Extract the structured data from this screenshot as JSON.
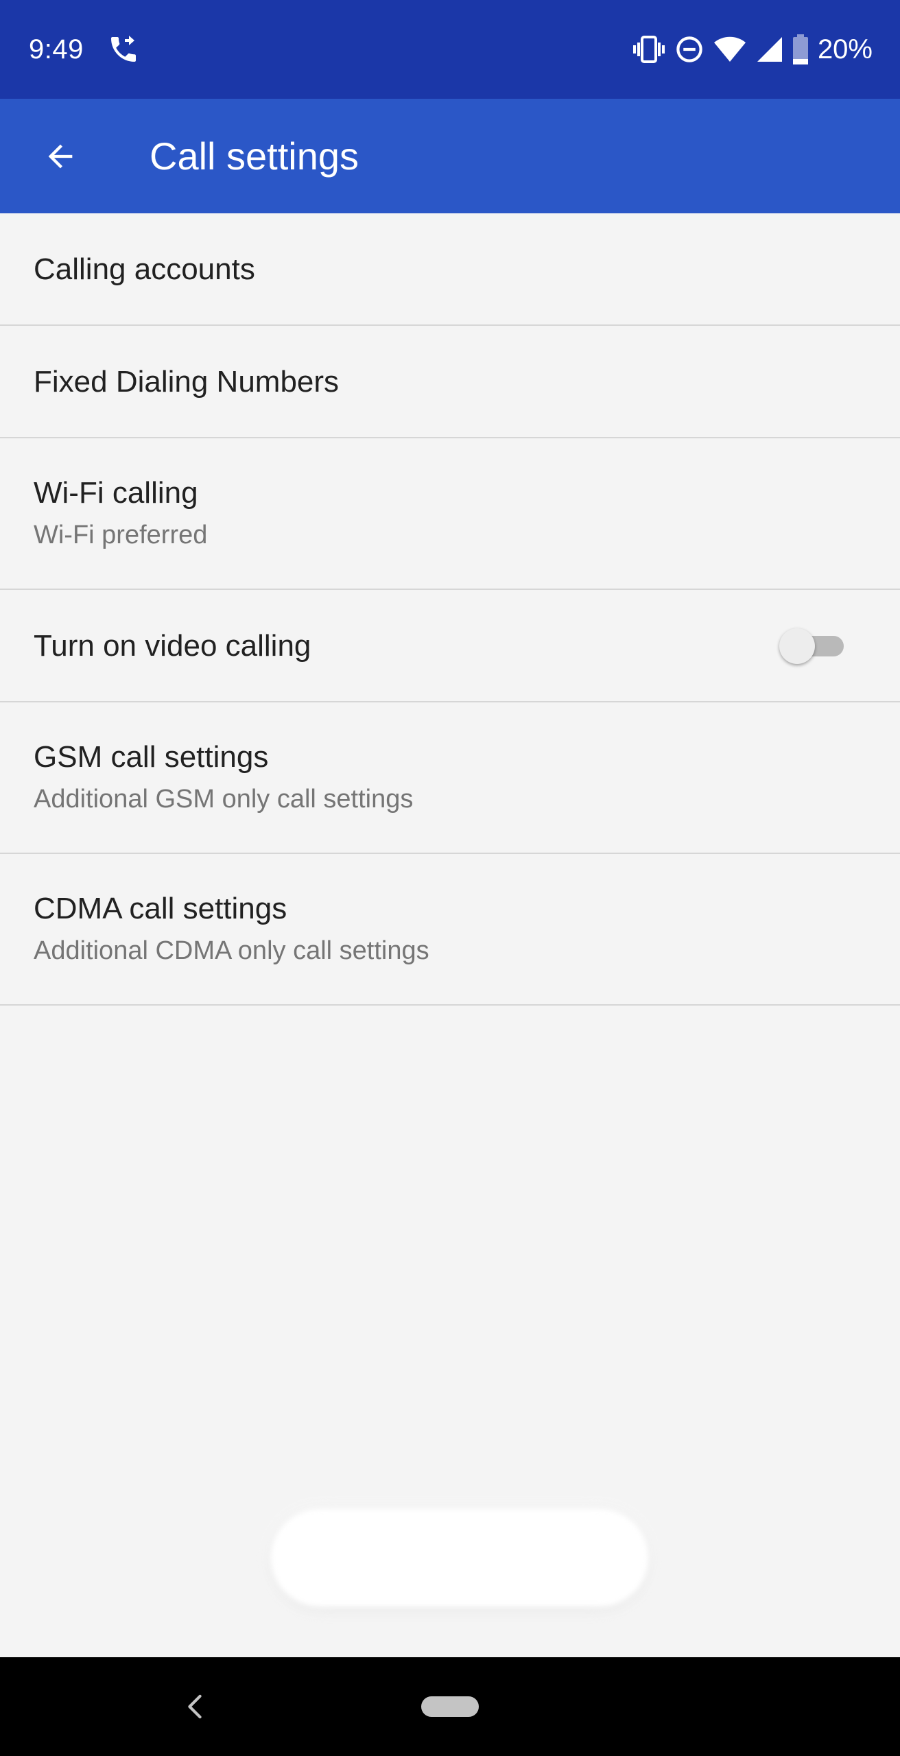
{
  "status_bar": {
    "time": "9:49",
    "battery_percent": "20%",
    "battery_level": 0.2,
    "icons": [
      "call-forwarding-icon",
      "vibrate-icon",
      "do-not-disturb-icon",
      "wifi-icon",
      "cell-signal-icon",
      "battery-icon"
    ]
  },
  "app_bar": {
    "back_icon": "arrow-back-icon",
    "title": "Call settings"
  },
  "settings": {
    "items": [
      {
        "title": "Calling accounts"
      },
      {
        "title": "Fixed Dialing Numbers"
      },
      {
        "title": "Wi-Fi calling",
        "summary": "Wi-Fi preferred"
      },
      {
        "title": "Turn on video calling",
        "toggle_on": false
      },
      {
        "title": "GSM call settings",
        "summary": "Additional GSM only call settings"
      },
      {
        "title": "CDMA call settings",
        "summary": "Additional CDMA only call settings"
      }
    ]
  },
  "nav_bar": {
    "back_icon": "nav-back-icon",
    "home_icon": "home-pill-icon"
  },
  "colors": {
    "status_bar": "#1b37a8",
    "app_bar": "#2b57c7",
    "background": "#f4f4f4",
    "divider": "#d6d6d6",
    "title_text": "#212121",
    "summary_text": "#757575"
  }
}
